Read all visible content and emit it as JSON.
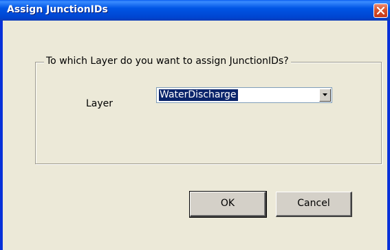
{
  "window": {
    "title": "Assign JunctionIDs"
  },
  "dialog": {
    "group_label": "To which Layer do you want to assign JunctionIDs?",
    "layer_label": "Layer",
    "layer_value": "WaterDischarge"
  },
  "buttons": {
    "ok_label": "OK",
    "cancel_label": "Cancel"
  },
  "icons": {
    "close": "close-icon",
    "dropdown": "chevron-down-icon"
  },
  "colors": {
    "titlebar": "#0055e5",
    "client": "#ece9d8",
    "selection": "#0a246a"
  }
}
